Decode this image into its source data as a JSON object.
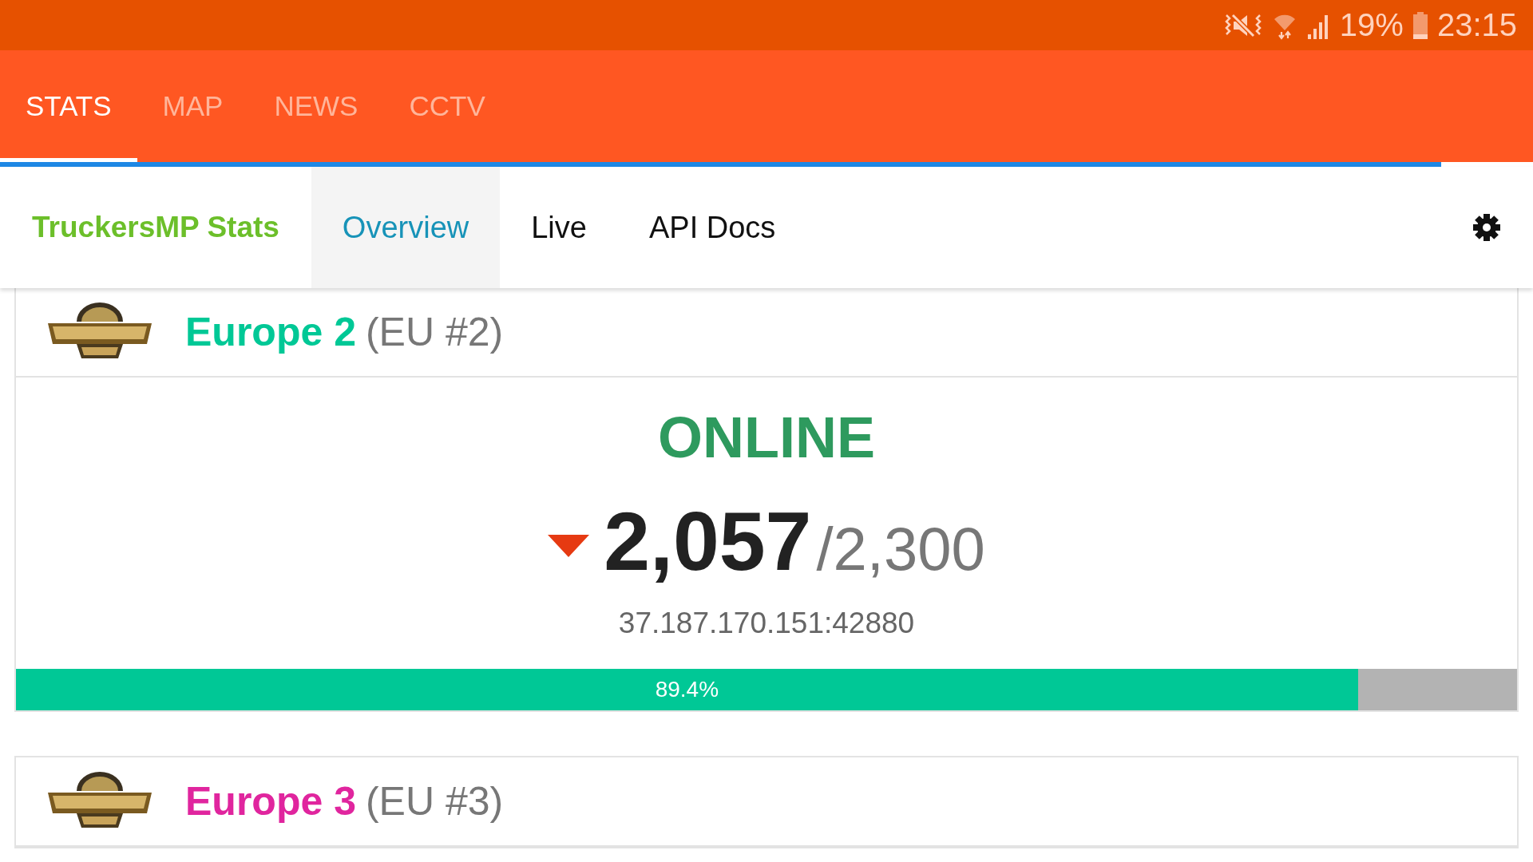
{
  "status_bar": {
    "battery": "19%",
    "time": "23:15"
  },
  "tabs": [
    {
      "label": "STATS",
      "selected": true
    },
    {
      "label": "MAP",
      "selected": false
    },
    {
      "label": "NEWS",
      "selected": false
    },
    {
      "label": "CCTV",
      "selected": false
    }
  ],
  "page_load": {
    "level": 0.94
  },
  "navbar": {
    "brand": "TruckersMP Stats",
    "items": [
      {
        "label": "Overview",
        "selected": true
      },
      {
        "label": "Live",
        "selected": false
      },
      {
        "label": "API Docs",
        "selected": false
      }
    ]
  },
  "servers": [
    {
      "name": "Europe 2",
      "short": "(EU #2)",
      "color": "#00c896",
      "status": "ONLINE",
      "falling": true,
      "players": "2,057",
      "capacity": "/2,300",
      "address": "37.187.170.151:42880",
      "level": 0.894,
      "percent": "89.4%"
    },
    {
      "name": "Europe 3",
      "short": "(EU #3)",
      "color": "#e0259e"
    }
  ]
}
